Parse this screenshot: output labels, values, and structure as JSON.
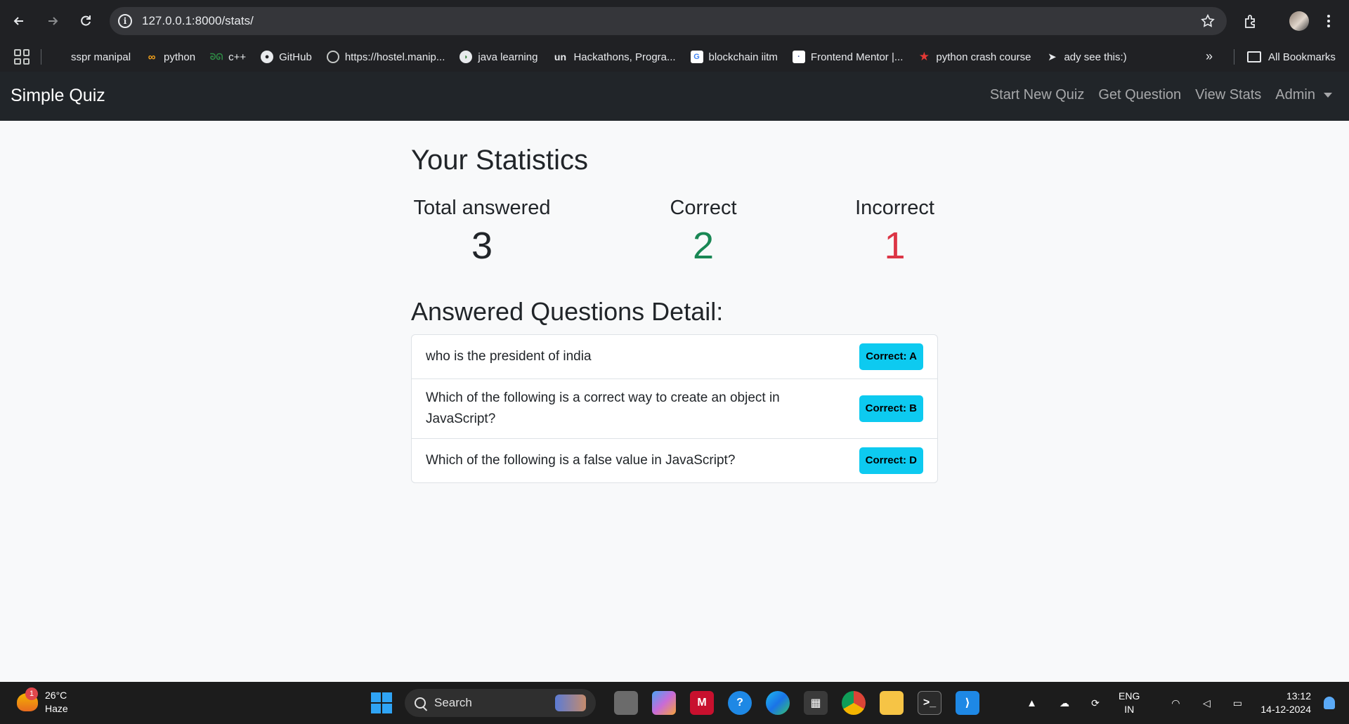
{
  "browser": {
    "url": "127.0.0.1:8000/stats/",
    "bookmarks": [
      {
        "label": "sspr manipal",
        "icon": "microsoft-icon",
        "color": "#f25022"
      },
      {
        "label": "python",
        "icon": "codechef-icon",
        "color": "#f6a31c"
      },
      {
        "label": "c++",
        "icon": "geeksforgeeks-icon",
        "color": "#2f8d46"
      },
      {
        "label": "GitHub",
        "icon": "github-icon",
        "color": "#ffffff"
      },
      {
        "label": "https://hostel.manip...",
        "icon": "globe-icon",
        "color": "#c4c7c5"
      },
      {
        "label": "java learning",
        "icon": "bird-icon",
        "color": "#ffffff"
      },
      {
        "label": "Hackathons, Progra...",
        "icon": "unstop-icon",
        "color": "#1c4ba8"
      },
      {
        "label": "blockchain iitm",
        "icon": "google-forms-icon",
        "color": "#4285f4"
      },
      {
        "label": "Frontend Mentor |...",
        "icon": "frontend-mentor-icon",
        "color": "#ffffff"
      },
      {
        "label": "python crash course",
        "icon": "star-icon",
        "color": "#e53935"
      },
      {
        "label": "ady see this:)",
        "icon": "arrow-icon",
        "color": "#ffffff"
      }
    ],
    "all_bookmarks": "All Bookmarks"
  },
  "navbar": {
    "brand": "Simple Quiz",
    "links": [
      "Start New Quiz",
      "Get Question",
      "View Stats",
      "Admin"
    ]
  },
  "main": {
    "title": "Your Statistics",
    "stats": {
      "total_label": "Total answered",
      "total_value": "3",
      "correct_label": "Correct",
      "correct_value": "2",
      "incorrect_label": "Incorrect",
      "incorrect_value": "1"
    },
    "detail_title": "Answered Questions Detail:",
    "questions": [
      {
        "text": "who is the president of india",
        "badge": "Correct: A"
      },
      {
        "text": "Which of the following is a correct way to create an object in JavaScript?",
        "badge": "Correct: B"
      },
      {
        "text": "Which of the following is a false value in JavaScript?",
        "badge": "Correct: D"
      }
    ]
  },
  "taskbar": {
    "weather_temp": "26°C",
    "weather_desc": "Haze",
    "weather_badge": "1",
    "search_label": "Search",
    "lang_1": "ENG",
    "lang_2": "IN",
    "time": "13:12",
    "date": "14-12-2024"
  },
  "colors": {
    "correct": "#198754",
    "incorrect": "#dc3545",
    "badge": "#0dcaf0",
    "navbar": "#212529"
  }
}
